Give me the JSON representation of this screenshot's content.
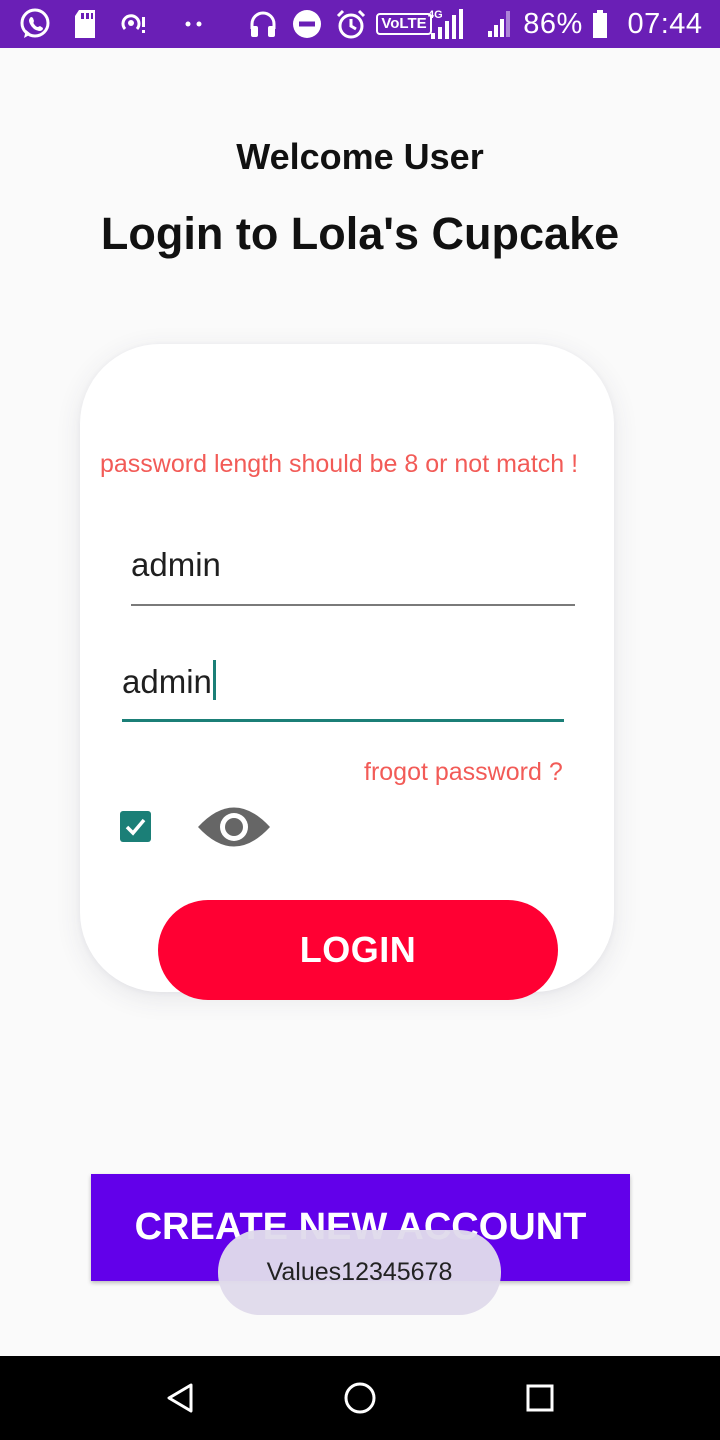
{
  "status_bar": {
    "icons": [
      "whatsapp-icon",
      "sd-card-icon",
      "hotspot-icon",
      "more-dots-icon",
      "headphones-icon",
      "do-not-disturb-icon",
      "alarm-icon",
      "volte-icon",
      "signal-icon",
      "signal-icon",
      "battery-icon"
    ],
    "volte_label": "VoLTE",
    "network_label": "4G",
    "battery": "86%",
    "time": "07:44"
  },
  "header": {
    "welcome": "Welcome User",
    "title": "Login to Lola's Cupcake"
  },
  "login_form": {
    "error_message": "password length should be 8 or not match !",
    "username_value": "admin",
    "password_value": "admin",
    "forgot_password": "frogot password ?",
    "remember_checked": true,
    "show_password_icon": "eye-icon",
    "login_label": "LOGIN"
  },
  "create_account_label": "CREATE NEW ACCOUNT",
  "toast": "Values12345678",
  "nav_bar": {
    "icons": [
      "back-icon",
      "home-icon",
      "recents-icon"
    ]
  },
  "colors": {
    "status_bar": "#6a1fb6",
    "error_text": "#f25b57",
    "accent_teal": "#1b7f77",
    "login_button": "#ff0033",
    "create_button": "#6200ea"
  }
}
